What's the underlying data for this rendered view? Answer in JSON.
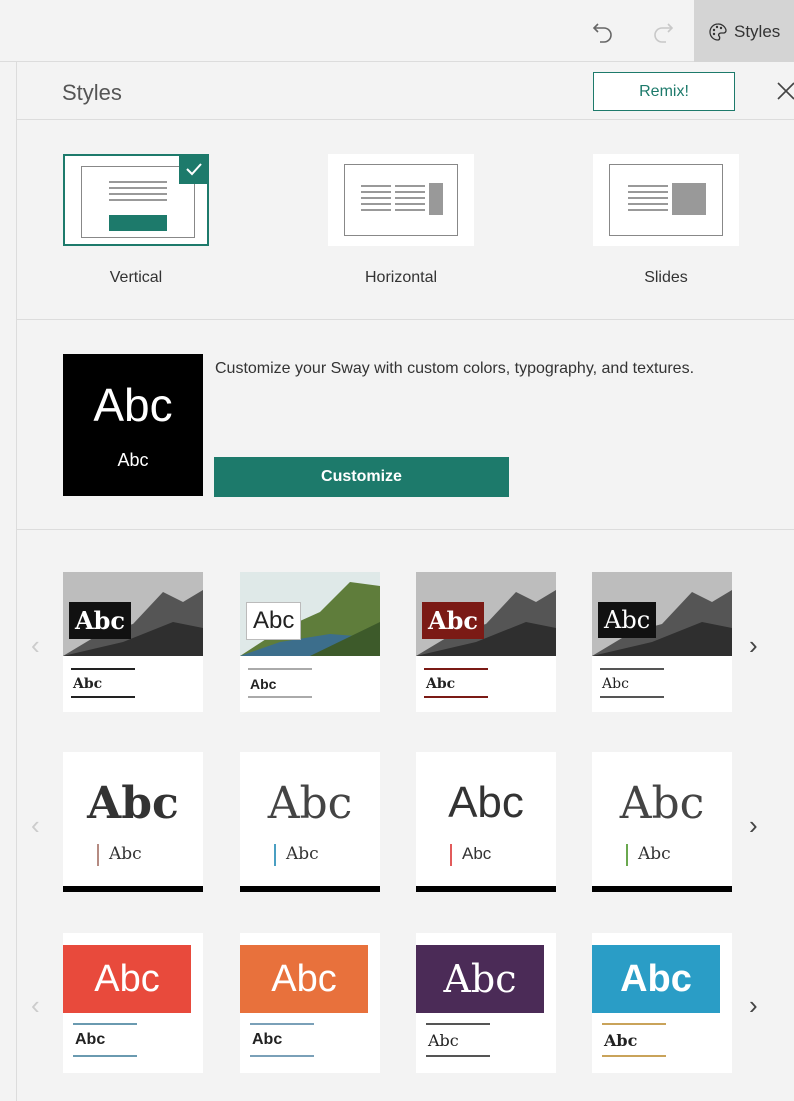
{
  "topbar": {
    "styles_label": "Styles"
  },
  "panel": {
    "title": "Styles",
    "remix_label": "Remix!",
    "layouts": [
      {
        "label": "Vertical",
        "selected": true
      },
      {
        "label": "Horizontal",
        "selected": false
      },
      {
        "label": "Slides",
        "selected": false
      }
    ],
    "customize": {
      "preview_big": "Abc",
      "preview_small": "Abc",
      "description": "Customize your Sway with custom colors, typography, and textures.",
      "button_label": "Customize"
    },
    "style_rows": [
      {
        "cards": [
          {
            "title": "Abc",
            "subtitle": "Abc"
          },
          {
            "title": "Abc",
            "subtitle": "Abc"
          },
          {
            "title": "Abc",
            "subtitle": "Abc"
          },
          {
            "title": "Abc",
            "subtitle": "Abc"
          }
        ]
      },
      {
        "cards": [
          {
            "title": "Abc",
            "subtitle": "Abc"
          },
          {
            "title": "Abc",
            "subtitle": "Abc"
          },
          {
            "title": "Abc",
            "subtitle": "Abc"
          },
          {
            "title": "Abc",
            "subtitle": "Abc"
          }
        ]
      },
      {
        "cards": [
          {
            "title": "Abc",
            "subtitle": "Abc"
          },
          {
            "title": "Abc",
            "subtitle": "Abc"
          },
          {
            "title": "Abc",
            "subtitle": "Abc"
          },
          {
            "title": "Abc",
            "subtitle": "Abc"
          }
        ]
      }
    ]
  },
  "colors": {
    "accent": "#1d7a6b",
    "accent_red": "#e84a3c",
    "accent_orange": "#e8713c",
    "accent_purple": "#4b2b57",
    "accent_blue": "#2a9dc6"
  },
  "icons": [
    "undo-icon",
    "redo-icon",
    "palette-icon",
    "close-icon",
    "checkmark-icon",
    "chevron-left-icon",
    "chevron-right-icon"
  ]
}
